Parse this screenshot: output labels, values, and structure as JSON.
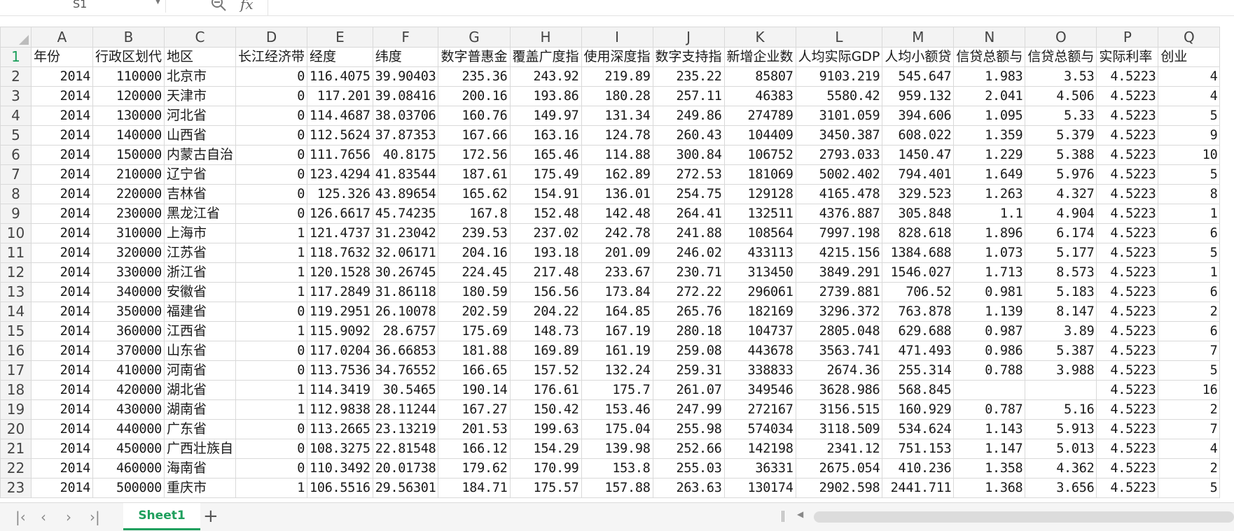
{
  "formula_bar": {
    "name_box": "S1",
    "fx_label": "fx"
  },
  "columns": [
    "A",
    "B",
    "C",
    "D",
    "E",
    "F",
    "G",
    "H",
    "I",
    "J",
    "K",
    "L",
    "M",
    "N",
    "O",
    "P",
    "Q"
  ],
  "header_row": [
    "年份",
    "行政区划代",
    "地区",
    "长江经济带",
    "经度",
    "纬度",
    "数字普惠金",
    "覆盖广度指",
    "使用深度指",
    "数字支持指",
    "新增企业数",
    "人均实际GDP",
    "人均小额贷",
    "信贷总额与",
    "信贷总额与",
    "实际利率",
    "创业"
  ],
  "rows": [
    [
      "2014",
      "110000",
      "北京市",
      "0",
      "116.4075",
      "39.90403",
      "235.36",
      "243.92",
      "219.89",
      "235.22",
      "85807",
      "9103.219",
      "545.647",
      "1.983",
      "3.53",
      "4.5223",
      "4"
    ],
    [
      "2014",
      "120000",
      "天津市",
      "0",
      "117.201",
      "39.08416",
      "200.16",
      "193.86",
      "180.28",
      "257.11",
      "46383",
      "5580.42",
      "959.132",
      "2.041",
      "4.506",
      "4.5223",
      "4"
    ],
    [
      "2014",
      "130000",
      "河北省",
      "0",
      "114.4687",
      "38.03706",
      "160.76",
      "149.97",
      "131.34",
      "249.86",
      "274789",
      "3101.059",
      "394.606",
      "1.095",
      "5.33",
      "4.5223",
      "5"
    ],
    [
      "2014",
      "140000",
      "山西省",
      "0",
      "112.5624",
      "37.87353",
      "167.66",
      "163.16",
      "124.78",
      "260.43",
      "104409",
      "3450.387",
      "608.022",
      "1.359",
      "5.379",
      "4.5223",
      "9"
    ],
    [
      "2014",
      "150000",
      "内蒙古自治",
      "0",
      "111.7656",
      "40.8175",
      "172.56",
      "165.46",
      "114.88",
      "300.84",
      "106752",
      "2793.033",
      "1450.47",
      "1.229",
      "5.388",
      "4.5223",
      "10"
    ],
    [
      "2014",
      "210000",
      "辽宁省",
      "0",
      "123.4294",
      "41.83544",
      "187.61",
      "175.49",
      "162.89",
      "272.53",
      "181069",
      "5002.402",
      "794.401",
      "1.649",
      "5.976",
      "4.5223",
      "5"
    ],
    [
      "2014",
      "220000",
      "吉林省",
      "0",
      "125.326",
      "43.89654",
      "165.62",
      "154.91",
      "136.01",
      "254.75",
      "129128",
      "4165.478",
      "329.523",
      "1.263",
      "4.327",
      "4.5223",
      "8"
    ],
    [
      "2014",
      "230000",
      "黑龙江省",
      "0",
      "126.6617",
      "45.74235",
      "167.8",
      "152.48",
      "142.48",
      "264.41",
      "132511",
      "4376.887",
      "305.848",
      "1.1",
      "4.904",
      "4.5223",
      "1"
    ],
    [
      "2014",
      "310000",
      "上海市",
      "1",
      "121.4737",
      "31.23042",
      "239.53",
      "237.02",
      "242.78",
      "241.88",
      "108564",
      "7997.198",
      "828.618",
      "1.896",
      "6.174",
      "4.5223",
      "6"
    ],
    [
      "2014",
      "320000",
      "江苏省",
      "1",
      "118.7632",
      "32.06171",
      "204.16",
      "193.18",
      "201.09",
      "246.02",
      "433113",
      "4215.156",
      "1384.688",
      "1.073",
      "5.177",
      "4.5223",
      "5"
    ],
    [
      "2014",
      "330000",
      "浙江省",
      "1",
      "120.1528",
      "30.26745",
      "224.45",
      "217.48",
      "233.67",
      "230.71",
      "313450",
      "3849.291",
      "1546.027",
      "1.713",
      "8.573",
      "4.5223",
      "1"
    ],
    [
      "2014",
      "340000",
      "安徽省",
      "1",
      "117.2849",
      "31.86118",
      "180.59",
      "156.56",
      "173.84",
      "272.22",
      "296061",
      "2739.881",
      "706.52",
      "0.981",
      "5.183",
      "4.5223",
      "6"
    ],
    [
      "2014",
      "350000",
      "福建省",
      "0",
      "119.2951",
      "26.10078",
      "202.59",
      "204.22",
      "164.85",
      "265.76",
      "182169",
      "3296.372",
      "763.878",
      "1.139",
      "8.147",
      "4.5223",
      "2"
    ],
    [
      "2014",
      "360000",
      "江西省",
      "1",
      "115.9092",
      "28.6757",
      "175.69",
      "148.73",
      "167.19",
      "280.18",
      "104737",
      "2805.048",
      "629.688",
      "0.987",
      "3.89",
      "4.5223",
      "6"
    ],
    [
      "2014",
      "370000",
      "山东省",
      "0",
      "117.0204",
      "36.66853",
      "181.88",
      "169.89",
      "161.19",
      "259.08",
      "443678",
      "3563.741",
      "471.493",
      "0.986",
      "5.387",
      "4.5223",
      "7"
    ],
    [
      "2014",
      "410000",
      "河南省",
      "0",
      "113.7536",
      "34.76552",
      "166.65",
      "157.52",
      "132.24",
      "259.31",
      "338833",
      "2674.36",
      "255.314",
      "0.788",
      "3.988",
      "4.5223",
      "5"
    ],
    [
      "2014",
      "420000",
      "湖北省",
      "1",
      "114.3419",
      "30.5465",
      "190.14",
      "176.61",
      "175.7",
      "261.07",
      "349546",
      "3628.986",
      "568.845",
      "",
      "",
      "4.5223",
      "16"
    ],
    [
      "2014",
      "430000",
      "湖南省",
      "1",
      "112.9838",
      "28.11244",
      "167.27",
      "150.42",
      "153.46",
      "247.99",
      "272167",
      "3156.515",
      "160.929",
      "0.787",
      "5.16",
      "4.5223",
      "2"
    ],
    [
      "2014",
      "440000",
      "广东省",
      "0",
      "113.2665",
      "23.13219",
      "201.53",
      "199.63",
      "175.04",
      "255.98",
      "574034",
      "3118.509",
      "534.624",
      "1.143",
      "5.913",
      "4.5223",
      "7"
    ],
    [
      "2014",
      "450000",
      "广西壮族自",
      "0",
      "108.3275",
      "22.81548",
      "166.12",
      "154.29",
      "139.98",
      "252.66",
      "142198",
      "2341.12",
      "751.153",
      "1.147",
      "5.013",
      "4.5223",
      "4"
    ],
    [
      "2014",
      "460000",
      "海南省",
      "0",
      "110.3492",
      "20.01738",
      "179.62",
      "170.99",
      "153.8",
      "255.03",
      "36331",
      "2675.054",
      "410.236",
      "1.358",
      "4.362",
      "4.5223",
      "2"
    ],
    [
      "2014",
      "500000",
      "重庆市",
      "1",
      "106.5516",
      "29.56301",
      "184.71",
      "175.57",
      "157.88",
      "263.63",
      "130174",
      "2902.598",
      "2441.711",
      "1.368",
      "3.656",
      "4.5223",
      "5"
    ]
  ],
  "sheet_tabs": [
    "Sheet1"
  ],
  "colors": {
    "accent": "#1e9f5d",
    "grid": "#d9d9d9",
    "header_bg": "#f3f3f3"
  }
}
